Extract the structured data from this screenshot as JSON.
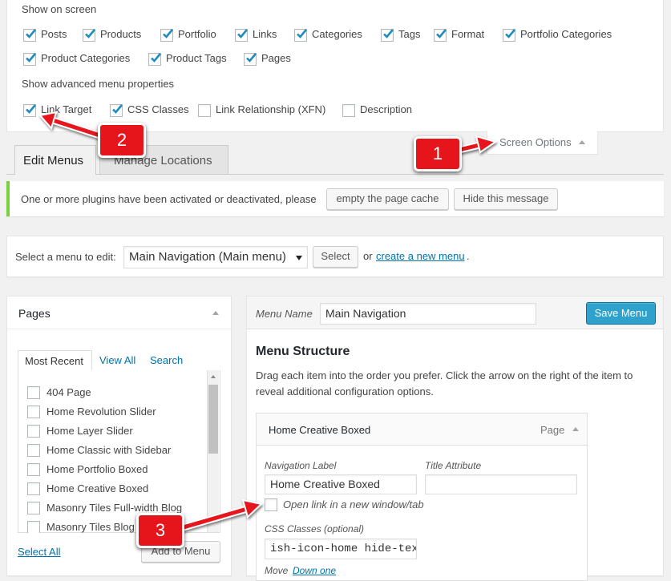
{
  "screen_options": {
    "show_on_screen_title": "Show on screen",
    "items": [
      {
        "label": "Posts",
        "checked": true
      },
      {
        "label": "Products",
        "checked": true
      },
      {
        "label": "Portfolio",
        "checked": true
      },
      {
        "label": "Links",
        "checked": true
      },
      {
        "label": "Categories",
        "checked": true
      },
      {
        "label": "Tags",
        "checked": true
      },
      {
        "label": "Format",
        "checked": true
      },
      {
        "label": "Portfolio Categories",
        "checked": true
      },
      {
        "label": "Product Categories",
        "checked": true
      },
      {
        "label": "Product Tags",
        "checked": true
      },
      {
        "label": "Pages",
        "checked": true
      }
    ],
    "advanced_title": "Show advanced menu properties",
    "advanced_items": [
      {
        "label": "Link Target",
        "checked": true
      },
      {
        "label": "CSS Classes",
        "checked": true
      },
      {
        "label": "Link Relationship (XFN)",
        "checked": false
      },
      {
        "label": "Description",
        "checked": false
      }
    ],
    "toggle_label": "Screen Options"
  },
  "tabs": [
    {
      "label": "Edit Menus",
      "active": true
    },
    {
      "label": "Manage Locations",
      "active": false
    }
  ],
  "notice": {
    "text": "One or more plugins have been activated or deactivated, please",
    "button1": "empty the page cache",
    "button2": "Hide this message",
    "accent_color": "#7ad03a"
  },
  "menu_select": {
    "label": "Select a menu to edit:",
    "selected": "Main Navigation (Main menu)",
    "select_button": "Select",
    "or_text": "or",
    "create_link": "create a new menu",
    "period": "."
  },
  "pages_panel": {
    "title": "Pages",
    "tabs": [
      "Most Recent",
      "View All",
      "Search"
    ],
    "items": [
      "404 Page",
      "Home Revolution Slider",
      "Home Layer Slider",
      "Home Classic with Sidebar",
      "Home Portfolio Boxed",
      "Home Creative Boxed",
      "Masonry Tiles Full-width Blog",
      "Masonry Tiles Blog"
    ],
    "select_all": "Select All",
    "add_button": "Add to Menu"
  },
  "menu_editor": {
    "name_label": "Menu Name",
    "name_value": "Main Navigation",
    "save_button": "Save Menu",
    "save_color": "#2ea2cc",
    "structure_title": "Menu Structure",
    "structure_desc": "Drag each item into the order you prefer. Click the arrow on the right of the item to reveal additional configuration options.",
    "item": {
      "title": "Home Creative Boxed",
      "type": "Page",
      "nav_label_title": "Navigation Label",
      "nav_label_value": "Home Creative Boxed",
      "title_attr_title": "Title Attribute",
      "title_attr_value": "",
      "new_window_label": "Open link in a new window/tab",
      "css_title": "CSS Classes (optional)",
      "css_value": "ish-icon-home hide-text",
      "move_label": "Move",
      "move_link": "Down one"
    }
  },
  "annotations": {
    "badge1": "1",
    "badge2": "2",
    "badge3": "3",
    "color": "#e6141b"
  }
}
